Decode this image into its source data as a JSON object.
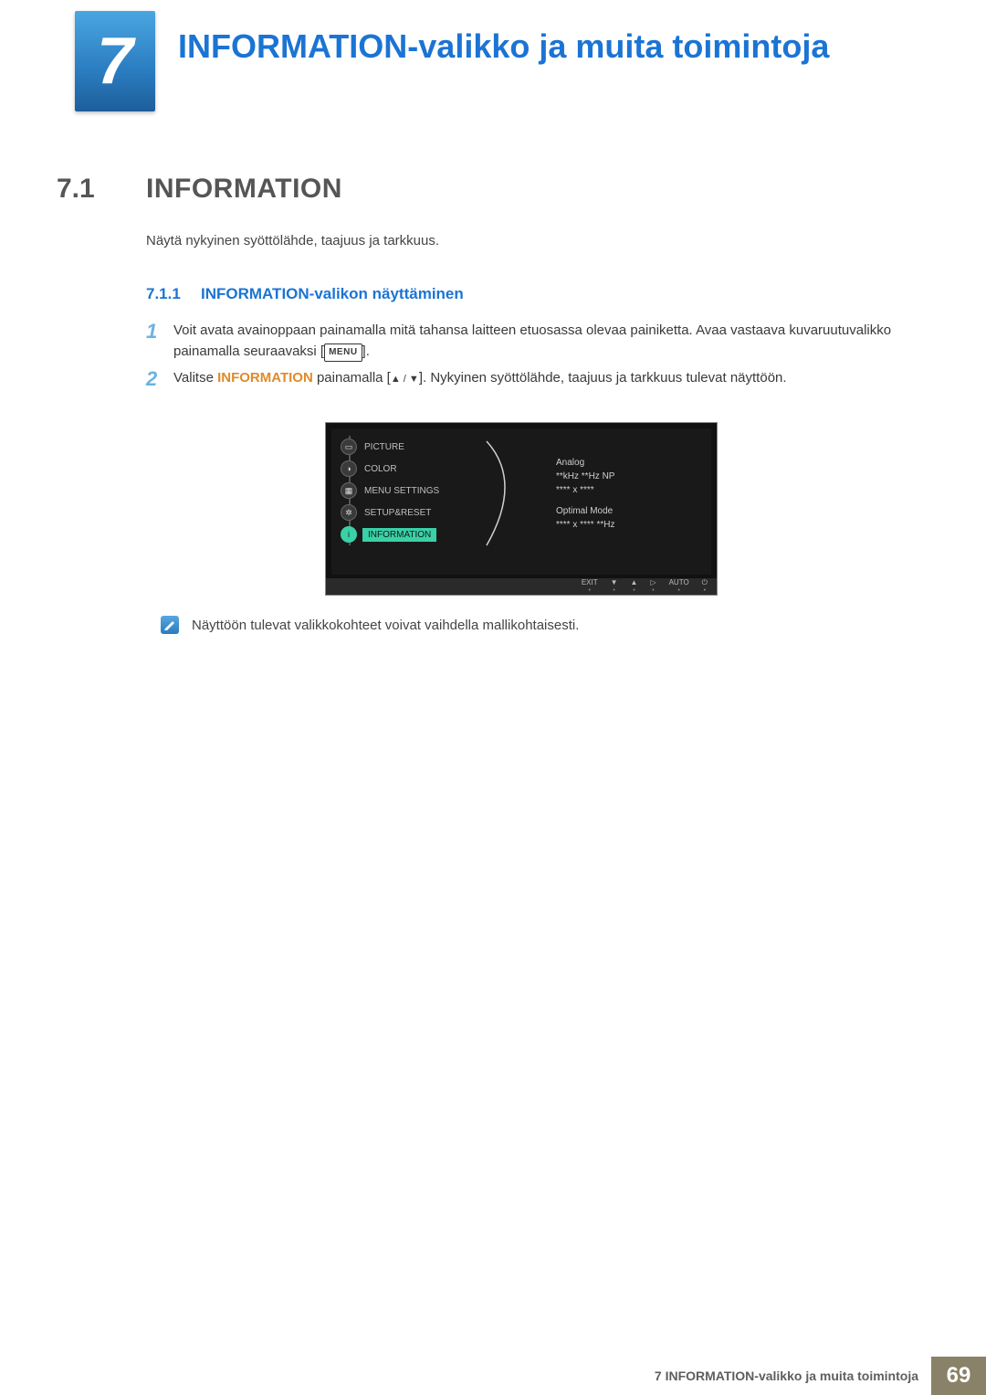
{
  "chapter": {
    "num": "7",
    "title": "INFORMATION-valikko ja muita toimintoja"
  },
  "section": {
    "num": "7.1",
    "title": "INFORMATION",
    "intro": "Näytä nykyinen syöttölähde, taajuus ja tarkkuus."
  },
  "subsection": {
    "num": "7.1.1",
    "title": "INFORMATION-valikon näyttäminen"
  },
  "steps": {
    "s1": {
      "n": "1",
      "text_a": "Voit avata avainoppaan painamalla mitä tahansa laitteen etuosassa olevaa painiketta. Avaa vastaava kuvaruutuvalikko painamalla seuraavaksi [",
      "menu": "MENU",
      "text_b": "]."
    },
    "s2": {
      "n": "2",
      "pre": "Valitse ",
      "hl": "INFORMATION",
      "mid": " painamalla [",
      "post": "]. Nykyinen syöttölähde, taajuus ja tarkkuus tulevat näyttöön."
    }
  },
  "osd": {
    "menu": [
      "PICTURE",
      "COLOR",
      "MENU SETTINGS",
      "SETUP&RESET",
      "INFORMATION"
    ],
    "info": {
      "l1": "Analog",
      "l2": "**kHz **Hz NP",
      "l3": "**** x ****",
      "l4": "Optimal Mode",
      "l5": "**** x **** **Hz"
    },
    "footer": {
      "exit": "EXIT",
      "auto": "AUTO"
    }
  },
  "note": "Näyttöön tulevat valikkokohteet voivat vaihdella mallikohtaisesti.",
  "footer": {
    "label": "7 INFORMATION-valikko ja muita toimintoja",
    "page": "69"
  }
}
